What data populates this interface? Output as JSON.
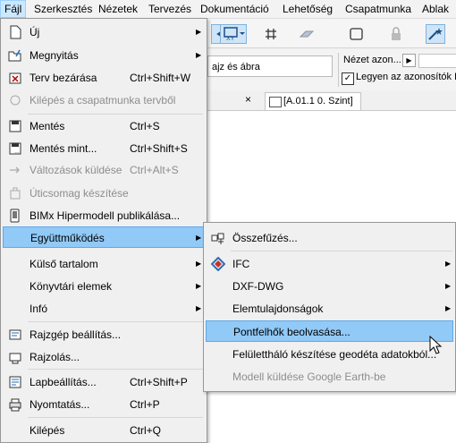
{
  "menubar": {
    "items": [
      {
        "label": "Fájl",
        "active": true
      },
      {
        "label": "Szerkesztés"
      },
      {
        "label": "Nézetek"
      },
      {
        "label": "Tervezés"
      },
      {
        "label": "Dokumentáció"
      },
      {
        "label": "Lehetőség"
      },
      {
        "label": "Csapatmunka"
      },
      {
        "label": "Ablak"
      }
    ]
  },
  "background": {
    "combo_text": "ajz és ábra",
    "nezet_label": "Nézet azon...",
    "checkbox_label": "Legyen az azonosítók L",
    "checkbox_checked": "✓",
    "tab_close": "×",
    "tab_label": "[A.01.1 0. Szint]"
  },
  "file_menu": {
    "items": [
      {
        "label": "Új",
        "submenu": true
      },
      {
        "label": "Megnyitás",
        "submenu": true
      },
      {
        "label": "Terv bezárása",
        "shortcut": "Ctrl+Shift+W"
      },
      {
        "label": "Kilépés a csapatmunka tervből",
        "disabled": true
      },
      {
        "label": "Mentés",
        "shortcut": "Ctrl+S"
      },
      {
        "label": "Mentés mint...",
        "shortcut": "Ctrl+Shift+S"
      },
      {
        "label": "Változások küldése",
        "shortcut": "Ctrl+Alt+S",
        "disabled": true
      },
      {
        "label": "Úticsomag készítése",
        "disabled": true
      },
      {
        "label": "BIMx Hipermodell publikálása..."
      },
      {
        "label": "Együttműködés",
        "submenu": true,
        "highlighted": true
      },
      {
        "label": "Külső tartalom",
        "submenu": true
      },
      {
        "label": "Könyvtári elemek",
        "submenu": true
      },
      {
        "label": "Infó",
        "submenu": true
      },
      {
        "label": "Rajzgép beállítás..."
      },
      {
        "label": "Rajzolás..."
      },
      {
        "label": "Lapbeállítás...",
        "shortcut": "Ctrl+Shift+P"
      },
      {
        "label": "Nyomtatás...",
        "shortcut": "Ctrl+P"
      },
      {
        "label": "Kilépés",
        "shortcut": "Ctrl+Q"
      }
    ]
  },
  "collab_menu": {
    "items": [
      {
        "label": "Összefűzés..."
      },
      {
        "label": "IFC",
        "submenu": true
      },
      {
        "label": "DXF-DWG",
        "submenu": true
      },
      {
        "label": "Elemtulajdonságok",
        "submenu": true
      },
      {
        "label": "Pontfelhők beolvasása...",
        "highlighted": true
      },
      {
        "label": "Felülettháló készítése geodéta adatokból..."
      },
      {
        "label": "Modell küldése Google Earth-be",
        "disabled": true
      }
    ]
  },
  "colors": {
    "highlight": "#91c9f7",
    "menubar_active": "#cce8ff",
    "disabled_text": "#8d8d8d"
  }
}
